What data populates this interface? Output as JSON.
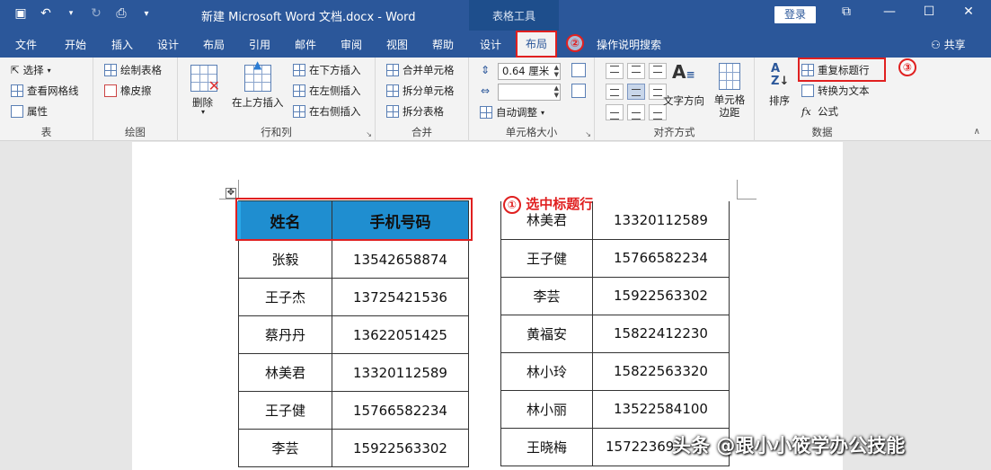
{
  "titlebar": {
    "doc_title": "新建 Microsoft Word 文档.docx  -  Word",
    "context_group": "表格工具",
    "login": "登录"
  },
  "tabs": [
    "文件",
    "开始",
    "插入",
    "设计",
    "布局",
    "引用",
    "邮件",
    "审阅",
    "视图",
    "帮助",
    "设计",
    "布局",
    "操作说明搜索"
  ],
  "active_tab": "布局",
  "share": "共享",
  "ribbon": {
    "table_group": {
      "select": "选择",
      "gridlines": "查看网格线",
      "properties": "属性",
      "label": "表"
    },
    "draw_group": {
      "draw_table": "绘制表格",
      "eraser": "橡皮擦",
      "label": "绘图"
    },
    "rows_cols_group": {
      "delete": "删除",
      "insert_above": "在上方插入",
      "insert_below": "在下方插入",
      "insert_left": "在左侧插入",
      "insert_right": "在右侧插入",
      "label": "行和列"
    },
    "merge_group": {
      "merge_cells": "合并单元格",
      "split_cells": "拆分单元格",
      "split_table": "拆分表格",
      "label": "合并"
    },
    "cell_size_group": {
      "height_value": "0.64 厘米",
      "width_value": "",
      "autofit": "自动调整",
      "label": "单元格大小"
    },
    "alignment_group": {
      "text_direction": "文字方向",
      "cell_margins": "单元格边距",
      "label": "对齐方式"
    },
    "data_group": {
      "sort": "排序",
      "repeat_header": "重复标题行",
      "convert_text": "转换为文本",
      "formula": "公式",
      "label": "数据"
    }
  },
  "annotations": {
    "step1": "①",
    "step1_text": "选中标题行",
    "step2": "②",
    "step3": "③"
  },
  "table_left": {
    "headers": [
      "姓名",
      "手机号码"
    ],
    "rows": [
      [
        "张毅",
        "13542658874"
      ],
      [
        "王子杰",
        "13725421536"
      ],
      [
        "蔡丹丹",
        "13622051425"
      ],
      [
        "林美君",
        "13320112589"
      ],
      [
        "王子健",
        "15766582234"
      ],
      [
        "李芸",
        "15922563302"
      ]
    ]
  },
  "table_right": {
    "rows": [
      [
        "林美君",
        "13320112589"
      ],
      [
        "王子健",
        "15766582234"
      ],
      [
        "李芸",
        "15922563302"
      ],
      [
        "黄福安",
        "15822412230"
      ],
      [
        "林小玲",
        "15822563320"
      ],
      [
        "林小丽",
        "13522584100"
      ],
      [
        "王晓梅",
        "15722369..."
      ]
    ]
  },
  "watermark": "头条 @跟小小筱学办公技能"
}
